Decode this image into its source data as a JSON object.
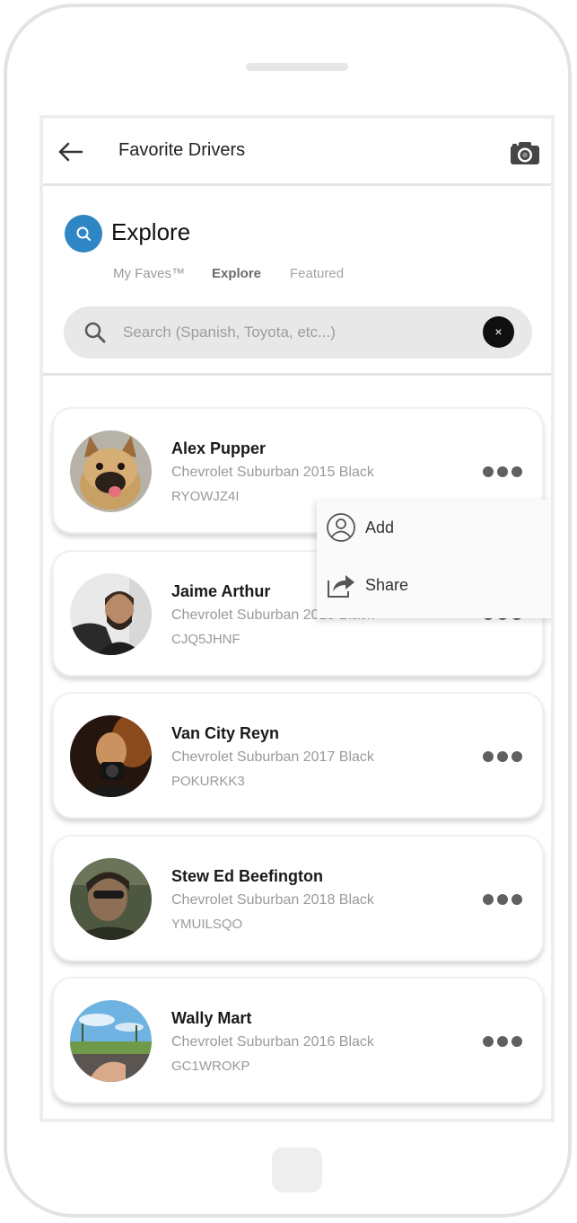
{
  "header": {
    "title": "Favorite Drivers"
  },
  "explore": {
    "title": "Explore"
  },
  "tabs": [
    {
      "label": "My Faves™"
    },
    {
      "label": "Explore"
    },
    {
      "label": "Featured"
    }
  ],
  "search": {
    "placeholder": "Search (Spanish, Toyota, etc...)",
    "clear_label": "×"
  },
  "drivers": [
    {
      "name": "Alex Pupper",
      "vehicle": "Chevrolet Suburban 2015 Black",
      "plate": "RYOWJZ4I"
    },
    {
      "name": "Jaime Arthur",
      "vehicle": "Chevrolet Suburban 2015 Black",
      "plate": "CJQ5JHNF"
    },
    {
      "name": "Van City Reyn",
      "vehicle": "Chevrolet Suburban 2017 Black",
      "plate": "POKURKK3"
    },
    {
      "name": "Stew Ed Beefington",
      "vehicle": "Chevrolet Suburban 2018 Black",
      "plate": "YMUILSQO"
    },
    {
      "name": "Wally Mart",
      "vehicle": "Chevrolet Suburban 2016 Black",
      "plate": "GC1WROKP"
    }
  ],
  "context_menu": {
    "items": [
      {
        "label": "Add",
        "icon": "person-add-icon"
      },
      {
        "label": "Share",
        "icon": "share-icon"
      }
    ]
  },
  "colors": {
    "accent": "#2f86c5",
    "search_bg": "#e8e8e8",
    "dots": "#606060"
  }
}
